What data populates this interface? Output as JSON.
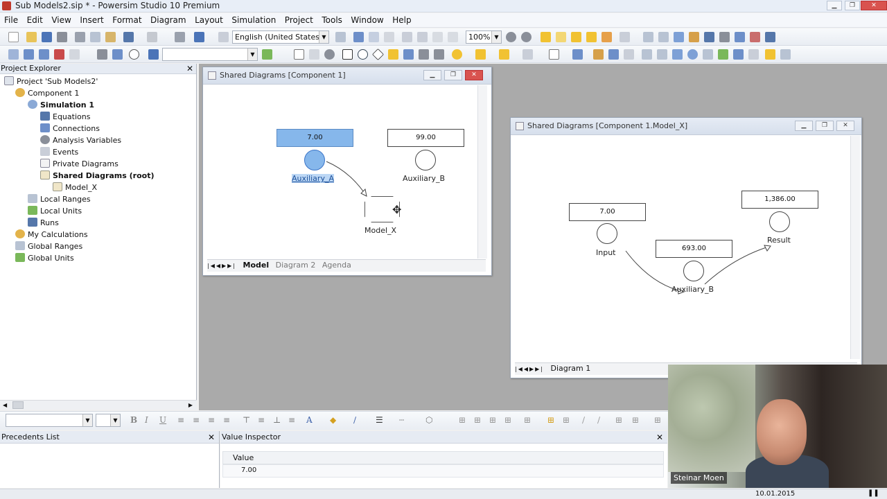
{
  "app": {
    "title": "Sub Models2.sip * - Powersim Studio 10 Premium"
  },
  "menu": [
    "File",
    "Edit",
    "View",
    "Insert",
    "Format",
    "Diagram",
    "Layout",
    "Simulation",
    "Project",
    "Tools",
    "Window",
    "Help"
  ],
  "toolbar": {
    "language": "English (United States)",
    "zoom": "100%"
  },
  "project_explorer": {
    "title": "Project Explorer",
    "items": [
      {
        "label": "Project 'Sub Models2'",
        "icon": "project-icon"
      },
      {
        "label": "Component 1",
        "icon": "component-icon"
      },
      {
        "label": "Simulation 1",
        "icon": "simulation-icon"
      },
      {
        "label": "Equations",
        "icon": "equations-icon"
      },
      {
        "label": "Connections",
        "icon": "connections-icon"
      },
      {
        "label": "Analysis Variables",
        "icon": "analysis-icon"
      },
      {
        "label": "Events",
        "icon": "events-icon"
      },
      {
        "label": "Private Diagrams",
        "icon": "diagram-icon"
      },
      {
        "label": "Shared Diagrams (root)",
        "icon": "diagram-icon"
      },
      {
        "label": "Model_X",
        "icon": "diagram-icon"
      },
      {
        "label": "Local Ranges",
        "icon": "ranges-icon"
      },
      {
        "label": "Local Units",
        "icon": "units-icon"
      },
      {
        "label": "Runs",
        "icon": "runs-icon"
      },
      {
        "label": "My Calculations",
        "icon": "component-icon"
      },
      {
        "label": "Global Ranges",
        "icon": "ranges-icon"
      },
      {
        "label": "Global Units",
        "icon": "units-icon"
      }
    ]
  },
  "window1": {
    "title": "Shared Diagrams [Component 1]",
    "aux_a_value": "7.00",
    "aux_a_label": "Auxiliary_A",
    "aux_b_value": "99.00",
    "aux_b_label": "Auxiliary_B",
    "model_label": "Model_X",
    "tabs": [
      "Model",
      "Diagram 2",
      "Agenda"
    ]
  },
  "window2": {
    "title": "Shared Diagrams [Component 1.Model_X]",
    "input_value": "7.00",
    "input_label": "Input",
    "aux_b_value": "693.00",
    "aux_b_label": "Auxiliary_B",
    "result_value": "1,386.00",
    "result_label": "Result",
    "tabs": [
      "Diagram 1"
    ]
  },
  "precedents": {
    "title": "Precedents List"
  },
  "value_inspector": {
    "title": "Value Inspector",
    "column": "Value",
    "value": "7.00"
  },
  "webcam": {
    "name": "Steinar Moen"
  },
  "status": {
    "date": "10.01.2015"
  }
}
